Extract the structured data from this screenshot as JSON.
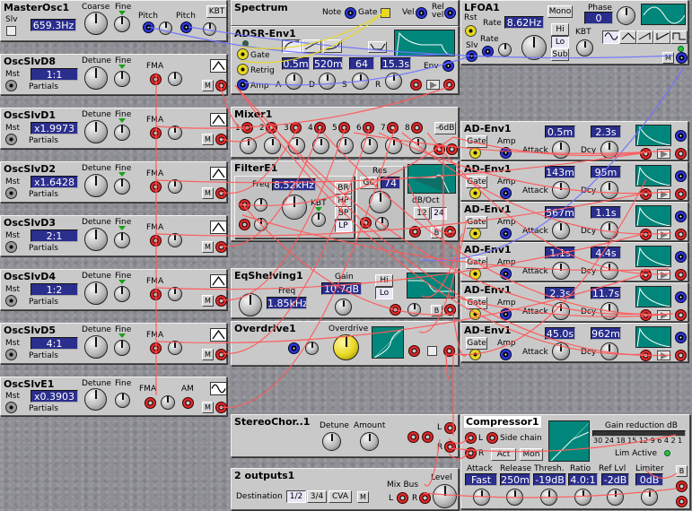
{
  "master": {
    "title": "MasterOsc1",
    "slv": "Slv",
    "coarse": "Coarse",
    "fine": "Fine",
    "freq": "659.3Hz",
    "pitch1": "Pitch",
    "pitch2": "Pitch",
    "kbt": "KBT"
  },
  "oscs": [
    {
      "title": "OscSlvD8",
      "mst": "Mst",
      "detune": "Detune",
      "fine": "Fine",
      "fma": "FMA",
      "ratio": "1:1",
      "partials": "Partials",
      "m": "M"
    },
    {
      "title": "OscSlvD1",
      "mst": "Mst",
      "detune": "Detune",
      "fine": "Fine",
      "fma": "FMA",
      "ratio": "x1.9973",
      "partials": "Partials",
      "m": "M"
    },
    {
      "title": "OscSlvD2",
      "mst": "Mst",
      "detune": "Detune",
      "fine": "Fine",
      "fma": "FMA",
      "ratio": "x1.6428",
      "partials": "Partials",
      "m": "M"
    },
    {
      "title": "OscSlvD3",
      "mst": "Mst",
      "detune": "Detune",
      "fine": "Fine",
      "fma": "FMA",
      "ratio": "2:1",
      "partials": "Partials",
      "m": "M"
    },
    {
      "title": "OscSlvD4",
      "mst": "Mst",
      "detune": "Detune",
      "fine": "Fine",
      "fma": "FMA",
      "ratio": "1:2",
      "partials": "Partials",
      "m": "M"
    },
    {
      "title": "OscSlvD5",
      "mst": "Mst",
      "detune": "Detune",
      "fine": "Fine",
      "fma": "FMA",
      "ratio": "4:1",
      "partials": "Partials",
      "m": "M"
    }
  ],
  "osce1": {
    "title": "OscSlvE1",
    "mst": "Mst",
    "detune": "Detune",
    "fine": "Fine",
    "fma": "FMA",
    "am": "AM",
    "ratio": "x0.3903",
    "partials": "Partials",
    "m": "M"
  },
  "spectrum": {
    "title": "Spectrum",
    "note": "Note",
    "gate": "Gate",
    "vel": "Vel",
    "relvel": "Rel vel"
  },
  "adsr": {
    "title": "ADSR-Env1",
    "gate": "Gate",
    "retrig": "Retrig",
    "amp": "Amp",
    "a": "A",
    "d": "D",
    "s": "S",
    "r": "R",
    "env": "Env",
    "a_val": "0.5m",
    "d_val": "520m",
    "s_val": "64",
    "r_val": "15.3s",
    "m": "M"
  },
  "lfo": {
    "title": "LFOA1",
    "rst": "Rst",
    "rate": "Rate",
    "rate_val": "8.62Hz",
    "mono": "Mono",
    "phase": "Phase",
    "phase_val": "0",
    "hi": "Hi",
    "lo": "Lo",
    "sub": "Sub",
    "kbt": "KBT",
    "slv": "Slv",
    "rate2": "Rate",
    "m": "M"
  },
  "mixer": {
    "title": "Mixer1",
    "labels": [
      "1",
      "2",
      "3",
      "4",
      "5",
      "6",
      "7",
      "8"
    ],
    "db": "-6dB"
  },
  "filter": {
    "title": "FilterE1",
    "freq": "Freq",
    "freq_val": "8.52kHz",
    "kbt": "KBT",
    "res": "Res",
    "gc": "GC",
    "res_val": "74",
    "br": "BR",
    "hp": "HP",
    "bp": "BP",
    "lp": "LP",
    "dboct": "dB/Oct",
    "o12": "12",
    "o24": "24",
    "b": "B"
  },
  "eq": {
    "title": "EqShelving1",
    "gain": "Gain",
    "gain_val": "10.7dB",
    "freq": "Freq",
    "freq_val": "1.85kHz",
    "hi": "Hi",
    "lo": "Lo",
    "b": "B"
  },
  "overdrive": {
    "title": "Overdrive1",
    "label": "Overdrive"
  },
  "adenvs": [
    {
      "title": "AD-Env1",
      "gate": "Gate",
      "amp": "Amp",
      "attack": "Attack",
      "dcy": "Dcy",
      "a_val": "0.5m",
      "d_val": "2.3s"
    },
    {
      "title": "AD-Env1",
      "gate": "Gate",
      "amp": "Amp",
      "attack": "Attack",
      "dcy": "Dcy",
      "a_val": "143m",
      "d_val": "95m"
    },
    {
      "title": "AD-Env1",
      "gate": "Gate",
      "amp": "Amp",
      "attack": "Attack",
      "dcy": "Dcy",
      "a_val": "567m",
      "d_val": "1.1s"
    },
    {
      "title": "AD-Env1",
      "gate": "Gate",
      "amp": "Amp",
      "attack": "Attack",
      "dcy": "Dcy",
      "a_val": "1.1s",
      "d_val": "4.4s"
    },
    {
      "title": "AD-Env1",
      "gate": "Gate",
      "amp": "Amp",
      "attack": "Attack",
      "dcy": "Dcy",
      "a_val": "2.3s",
      "d_val": "11.7s"
    },
    {
      "title": "AD-Env1",
      "gate": "Gate",
      "amp": "Amp",
      "attack": "Attack",
      "dcy": "Dcy",
      "a_val": "45.0s",
      "d_val": "962m"
    }
  ],
  "chorus": {
    "title": "StereoChor..1",
    "detune": "Detune",
    "amount": "Amount",
    "l": "L",
    "r": "R"
  },
  "comp": {
    "title": "Compressor1",
    "l": "L",
    "r": "R",
    "sidechain": "Side chain",
    "act": "Act",
    "mon": "Mon",
    "gr": "Gain reduction  dB",
    "scale": "30 24 18 15 12  9  6  4  2  1",
    "lim": "Lim Active",
    "attack": "Attack",
    "release": "Release",
    "thresh": "Thresh.",
    "ratio": "Ratio",
    "reflvl": "Ref Lvl",
    "limiter": "Limiter",
    "attack_val": "Fast",
    "release_val": "250m",
    "thresh_val": "-19dB",
    "ratio_val": "4.0:1",
    "reflvl_val": "-2dB",
    "limiter_val": "0dB",
    "b": "B"
  },
  "out": {
    "title": "2 outputs1",
    "dest": "Destination",
    "d1": "1/2",
    "d2": "3/4",
    "d3": "CVA",
    "m": "M",
    "mixbus": "Mix Bus",
    "level": "Level",
    "l": "L",
    "r": "R"
  },
  "colors": {
    "bg": "#8d8d94",
    "panel": "#c9c9c9",
    "display": "#2a2e8c",
    "screen": "#00867a",
    "cable_red": "#ff5a5a",
    "cable_blue": "#6f74ff",
    "cable_yellow": "#e8d820"
  }
}
